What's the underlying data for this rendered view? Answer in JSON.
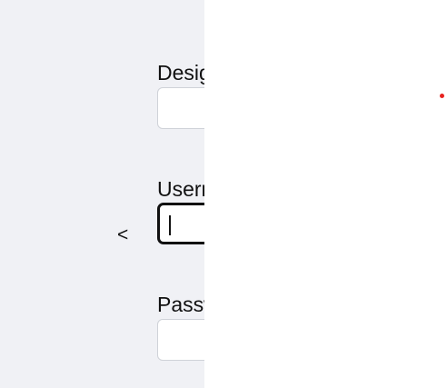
{
  "form": {
    "back_glyph": "<",
    "designation": {
      "label": "Designation",
      "value": ""
    },
    "username": {
      "label": "Username",
      "value": "",
      "focused": true
    },
    "password": {
      "label": "Password",
      "value": ""
    }
  },
  "colors": {
    "left_panel_bg": "#f0f1f5",
    "right_panel_bg": "#ffffff",
    "status_dot": "#e8231f",
    "focus_border": "#111111"
  },
  "icons": {
    "back": "chevron-left-icon",
    "status": "red-dot-indicator"
  }
}
